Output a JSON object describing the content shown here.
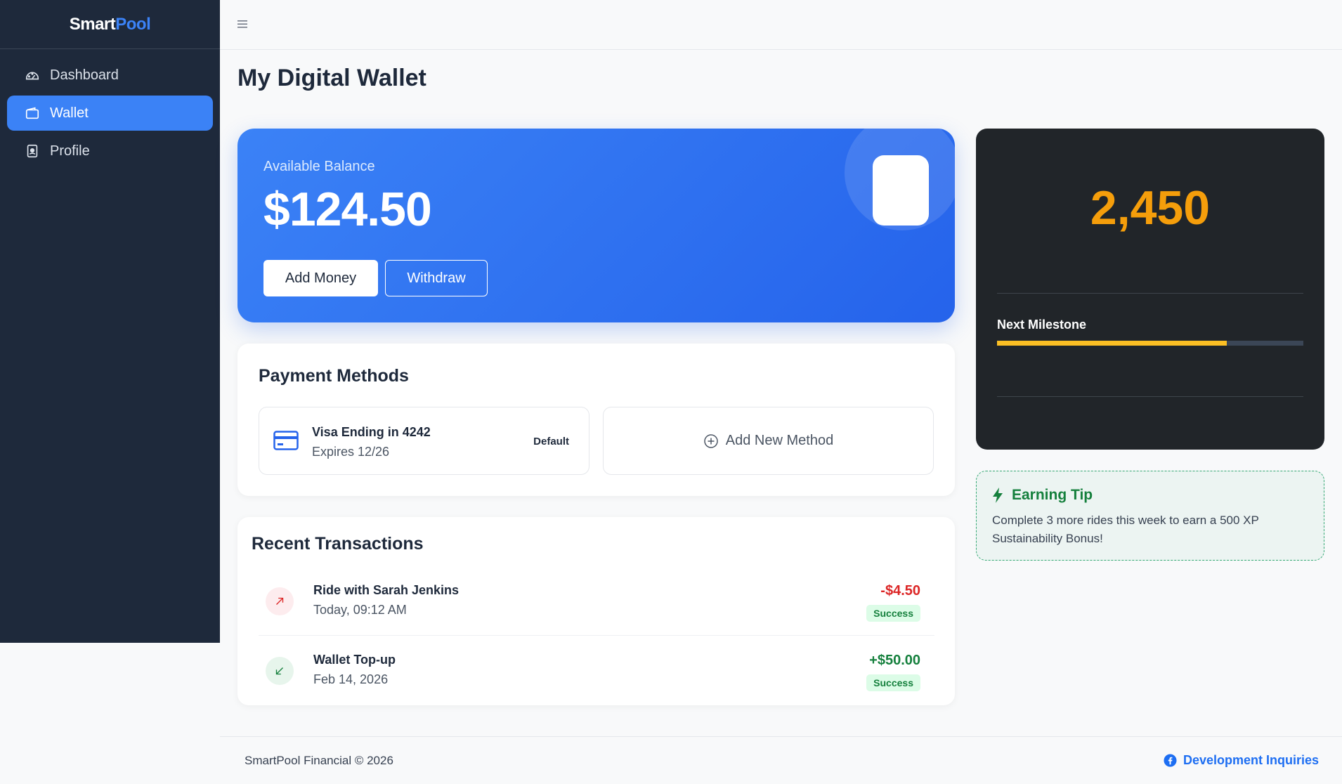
{
  "brand": {
    "part1": "Smart",
    "part2": "Pool"
  },
  "sidebar": {
    "items": [
      {
        "label": "Dashboard",
        "icon": "speedometer-icon"
      },
      {
        "label": "Wallet",
        "icon": "wallet-icon",
        "active": true
      },
      {
        "label": "Profile",
        "icon": "badge-icon"
      }
    ]
  },
  "page": {
    "title": "My Digital Wallet"
  },
  "balance": {
    "label": "Available Balance",
    "amount": "$124.50",
    "add_label": "Add Money",
    "withdraw_label": "Withdraw"
  },
  "payment_methods": {
    "title": "Payment Methods",
    "card": {
      "name": "Visa Ending in 4242",
      "expires": "Expires 12/26",
      "badge": "Default"
    },
    "add_label": "Add New Method"
  },
  "transactions": {
    "title": "Recent Transactions",
    "items": [
      {
        "name": "Ride with Sarah Jenkins",
        "date": "Today, 09:12 AM",
        "amount": "-$4.50",
        "status": "Success",
        "direction": "out"
      },
      {
        "name": "Wallet Top-up",
        "date": "Feb 14, 2026",
        "amount": "+$50.00",
        "status": "Success",
        "direction": "in"
      }
    ]
  },
  "xp": {
    "value": "2,450",
    "milestone_label": "Next Milestone",
    "progress": 0.75
  },
  "tip": {
    "title": "Earning Tip",
    "text": "Complete 3 more rides this week to earn a 500 XP Sustainability Bonus!"
  },
  "footer": {
    "copyright": "SmartPool Financial © 2026",
    "link": "Development Inquiries"
  },
  "colors": {
    "sidebar_bg": "#1e293b",
    "accent": "#3b82f6",
    "xp_gold": "#f59e0b",
    "success": "#15803d",
    "danger": "#dc2626"
  }
}
